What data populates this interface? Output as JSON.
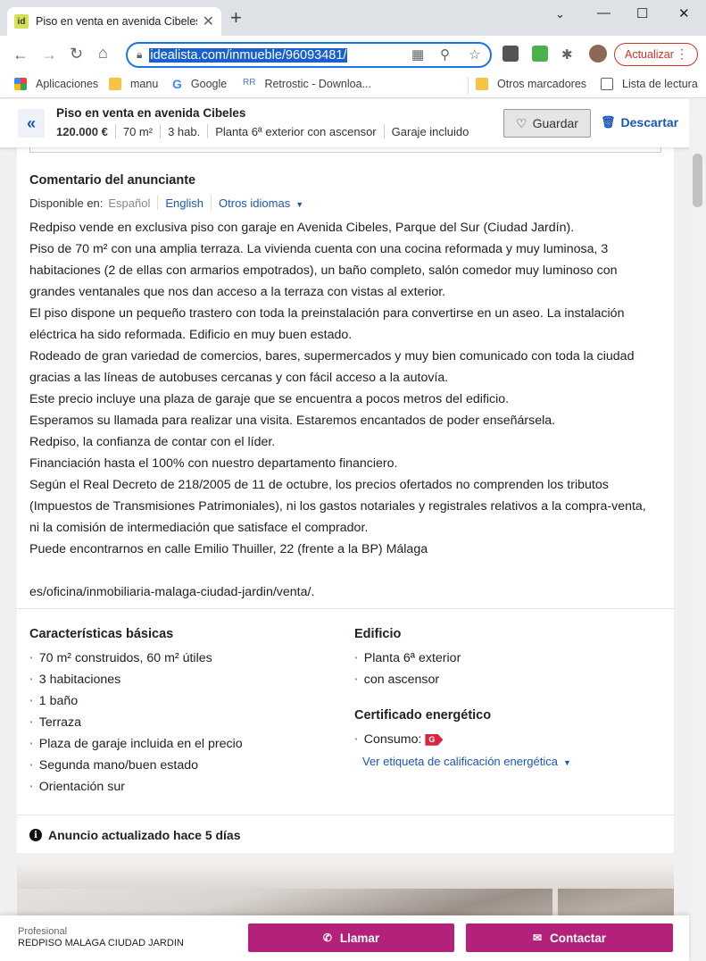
{
  "browser": {
    "tab_title": "Piso en venta en avenida Cibeles",
    "favicon_text": "id",
    "url": "idealista.com/inmueble/96093481/",
    "update_button": "Actualizar",
    "bookmarks": [
      "Aplicaciones",
      "manu",
      "Google",
      "Retrostic - Downloa...",
      "Otros marcadores",
      "Lista de lectura"
    ]
  },
  "header": {
    "title": "Piso en venta en avenida Cibeles",
    "price": "120.000 €",
    "area": "70 m²",
    "rooms": "3 hab.",
    "floor": "Planta 6ª exterior con ascensor",
    "garage": "Garaje incluido",
    "save_label": "Guardar",
    "discard_label": "Descartar"
  },
  "comment": {
    "heading": "Comentario del anunciante",
    "available_label": "Disponible en:",
    "lang_current": "Español",
    "lang_en": "English",
    "lang_other": "Otros idiomas",
    "lines": [
      "Redpiso vende en exclusiva piso con garaje en Avenida Cibeles, Parque del Sur (Ciudad Jardín).",
      "Piso de 70 m² con una amplia terraza. La vivienda cuenta con una cocina reformada y muy luminosa, 3",
      "habitaciones (2 de ellas con armarios empotrados), un baño completo, salón comedor muy luminoso con",
      "grandes ventanales que nos dan acceso a la terraza con vistas al exterior.",
      "El piso dispone un pequeño trastero con toda la preinstalación para convertirse en un aseo. La instalación",
      "eléctrica ha sido reformada. Edificio en muy buen estado.",
      "Rodeado de gran variedad de comercios, bares, supermercados y muy bien comunicado con toda la ciudad",
      "gracias a las líneas de autobuses cercanas y con fácil acceso a la autovía.",
      "Este precio incluye una plaza de garaje que se encuentra a pocos metros del edificio.",
      "Esperamos su llamada para realizar una visita. Estaremos encantados de poder enseñársela.",
      "Redpiso, la confianza de contar con el líder.",
      "Financiación hasta el 100% con nuestro departamento financiero.",
      "Según el Real Decreto de 218/2005 de 11 de octubre, los precios ofertados no comprenden los tributos",
      "(Impuestos de Transmisiones Patrimoniales), ni los gastos notariales y registrales relativos a la compra-venta,",
      "ni la comisión de intermediación que satisface el comprador.",
      "Puede encontrarnos en calle Emilio Thuiller, 22 (frente a la BP) Málaga"
    ],
    "last_line": "es/oficina/inmobiliaria-malaga-ciudad-jardin/venta/."
  },
  "basic": {
    "heading": "Características básicas",
    "items": [
      "70 m² construidos, 60 m² útiles",
      "3 habitaciones",
      "1 baño",
      "Terraza",
      "Plaza de garaje incluida en el precio",
      "Segunda mano/buen estado",
      "Orientación sur"
    ]
  },
  "building": {
    "heading": "Edificio",
    "items": [
      "Planta 6ª exterior",
      "con ascensor"
    ]
  },
  "energy": {
    "heading": "Certificado energético",
    "consumption_label": "Consumo:",
    "rating": "G",
    "rating_color": "#d7263d",
    "link": "Ver etiqueta de calificación energética"
  },
  "updated": "Anuncio actualizado hace 5 días",
  "footer": {
    "type_label": "Profesional",
    "agency": "REDPISO MALAGA CIUDAD JARDIN",
    "call_label": "Llamar",
    "contact_label": "Contactar",
    "cta_color": "#b3217a"
  }
}
